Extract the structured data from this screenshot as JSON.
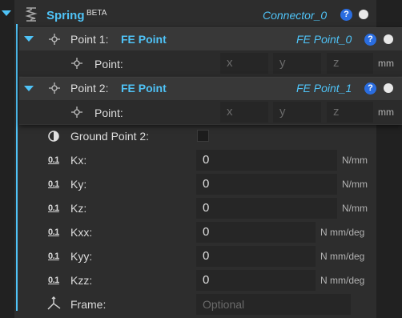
{
  "spring": {
    "title": "Spring",
    "badge": "BETA",
    "connector": "Connector_0",
    "help": "?"
  },
  "point1": {
    "label": "Point 1:",
    "type": "FE Point",
    "ref": "FE Point_0",
    "help": "?",
    "point_label": "Point:",
    "x_placeholder": "x",
    "y_placeholder": "y",
    "z_placeholder": "z",
    "unit": "mm"
  },
  "point2": {
    "label": "Point 2:",
    "type": "FE Point",
    "ref": "FE Point_1",
    "help": "?",
    "point_label": "Point:",
    "x_placeholder": "x",
    "y_placeholder": "y",
    "z_placeholder": "z",
    "unit": "mm"
  },
  "ground_point2": {
    "label": "Ground Point 2:",
    "checked": false
  },
  "params": [
    {
      "icon": "0.1",
      "label": "Kx:",
      "value": "0",
      "unit": "N/mm"
    },
    {
      "icon": "0.1",
      "label": "Ky:",
      "value": "0",
      "unit": "N/mm"
    },
    {
      "icon": "0.1",
      "label": "Kz:",
      "value": "0",
      "unit": "N/mm"
    },
    {
      "icon": "0.1",
      "label": "Kxx:",
      "value": "0",
      "unit": "N mm/deg"
    },
    {
      "icon": "0.1",
      "label": "Kyy:",
      "value": "0",
      "unit": "N mm/deg"
    },
    {
      "icon": "0.1",
      "label": "Kzz:",
      "value": "0",
      "unit": "N mm/deg"
    }
  ],
  "frame": {
    "label": "Frame:",
    "placeholder": "Optional"
  },
  "colors": {
    "accent": "#4fc3f7",
    "help": "#2a6de0",
    "panel": "#2d2d2d",
    "field": "#262626"
  }
}
